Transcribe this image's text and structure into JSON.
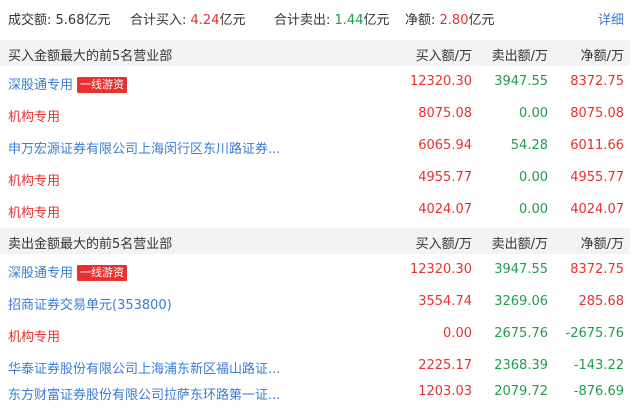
{
  "summary": {
    "turnover_label": "成交额:",
    "turnover_value": "5.68",
    "buy_label": "合计买入:",
    "buy_value": "4.24",
    "sell_label": "合计卖出:",
    "sell_value": "1.44",
    "net_label": "净额:",
    "net_value": "2.80",
    "unit": "亿元",
    "detail_link": "详细"
  },
  "buy_section": {
    "title": "买入金额最大的前5名营业部",
    "columns": [
      "买入额/万",
      "卖出额/万",
      "净额/万"
    ],
    "rows": [
      {
        "name": "深股通专用",
        "badge": "一线游资",
        "buy": "12320.30",
        "sell": "3947.55",
        "net": "8372.75"
      },
      {
        "name": "机构专用",
        "badge": "",
        "buy": "8075.08",
        "sell": "0.00",
        "net": "8075.08"
      },
      {
        "name": "申万宏源证券有限公司上海闵行区东川路证券...",
        "badge": "",
        "buy": "6065.94",
        "sell": "54.28",
        "net": "6011.66"
      },
      {
        "name": "机构专用",
        "badge": "",
        "buy": "4955.77",
        "sell": "0.00",
        "net": "4955.77"
      },
      {
        "name": "机构专用",
        "badge": "",
        "buy": "4024.07",
        "sell": "0.00",
        "net": "4024.07"
      }
    ]
  },
  "sell_section": {
    "title": "卖出金额最大的前5名营业部",
    "columns": [
      "买入额/万",
      "卖出额/万",
      "净额/万"
    ],
    "rows": [
      {
        "name": "深股通专用",
        "badge": "一线游资",
        "buy": "12320.30",
        "sell": "3947.55",
        "net": "8372.75"
      },
      {
        "name": "招商证券交易单元(353800)",
        "badge": "",
        "buy": "3554.74",
        "sell": "3269.06",
        "net": "285.68"
      },
      {
        "name": "机构专用",
        "badge": "",
        "buy": "0.00",
        "sell": "2675.76",
        "net": "-2675.76"
      },
      {
        "name": "华泰证券股份有限公司上海浦东新区福山路证...",
        "badge": "",
        "buy": "2225.17",
        "sell": "2368.39",
        "net": "-143.22"
      },
      {
        "name": "东方财富证券股份有限公司拉萨东环路第一证...",
        "badge": "",
        "buy": "1203.03",
        "sell": "2079.72",
        "net": "-876.69"
      }
    ]
  },
  "colors": {
    "red": "#e93030",
    "green": "#1e9e4a",
    "blue": "#3a7bd5",
    "header_bg": "#f2f3f5"
  }
}
